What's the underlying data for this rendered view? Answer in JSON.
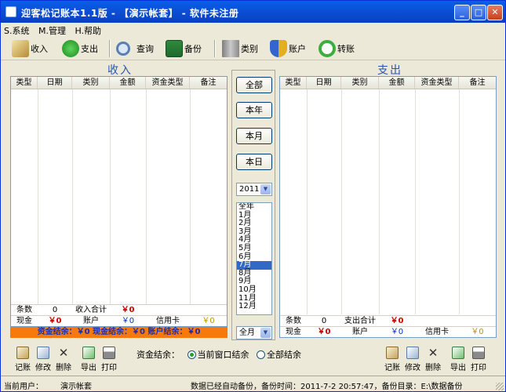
{
  "window": {
    "title": "迎客松记账本1.1版 - 【演示帐套】 - 软件未注册"
  },
  "menu": [
    "S.系统",
    "M.管理",
    "H.帮助"
  ],
  "toolbar": [
    {
      "label": "收入",
      "icon": "pencil-edit-icon"
    },
    {
      "label": "支出",
      "icon": "green-arrow-down-icon"
    },
    {
      "label": "查询",
      "icon": "magnifier-icon"
    },
    {
      "label": "备份",
      "icon": "floppy-disk-icon"
    },
    {
      "label": "类别",
      "icon": "book-icon"
    },
    {
      "label": "账户",
      "icon": "shield-icon"
    },
    {
      "label": "转账",
      "icon": "green-refresh-icon"
    }
  ],
  "income": {
    "title": "收入",
    "headers": [
      "类型",
      "日期",
      "类别",
      "金额",
      "资金类型",
      "备注"
    ],
    "summary": {
      "count_label": "条数",
      "count": "0",
      "total_label": "收入合计",
      "total": "￥0",
      "cash_label": "现金",
      "cash": "￥0",
      "account_label": "账户",
      "account": "￥0",
      "card_label": "信用卡",
      "card": "￥0"
    },
    "balance_bar": "资金结余：￥0  现金结余：￥0  账户结余：￥0"
  },
  "expense": {
    "title": "支出",
    "headers": [
      "类型",
      "日期",
      "类别",
      "金额",
      "资金类型",
      "备注"
    ],
    "summary": {
      "count_label": "条数",
      "count": "0",
      "total_label": "支出合计",
      "total": "￥0",
      "cash_label": "现金",
      "cash": "￥0",
      "account_label": "账户",
      "account": "￥0",
      "card_label": "信用卡",
      "card": "￥0"
    }
  },
  "period_buttons": [
    "全部",
    "本年",
    "本月",
    "本日"
  ],
  "year_select": "2011",
  "months": [
    "全年",
    "1月",
    "2月",
    "3月",
    "4月",
    "5月",
    "6月",
    "7月",
    "8月",
    "9月",
    "10月",
    "11月",
    "12月"
  ],
  "selected_month": "7月",
  "month_select": "全月",
  "bottom_left_buttons": [
    "记账",
    "修改",
    "删除",
    "导出",
    "打印"
  ],
  "bottom_right_buttons": [
    "记账",
    "修改",
    "删除",
    "导出",
    "打印"
  ],
  "balance_mode": {
    "label": "资金结余：",
    "option1": "当前窗口结余",
    "option2": "全部结余",
    "selected": "当前窗口结余"
  },
  "status": {
    "user_label": "当前用户：",
    "user": "演示帐套",
    "message": "数据已经自动备份，备份时间：2011-7-2 20:57:47，备份目录：E:\\数据备份"
  },
  "colors": {
    "accent": "#0a5fe8",
    "balance_bar": "#f47a10",
    "amount_red": "#d00000"
  }
}
